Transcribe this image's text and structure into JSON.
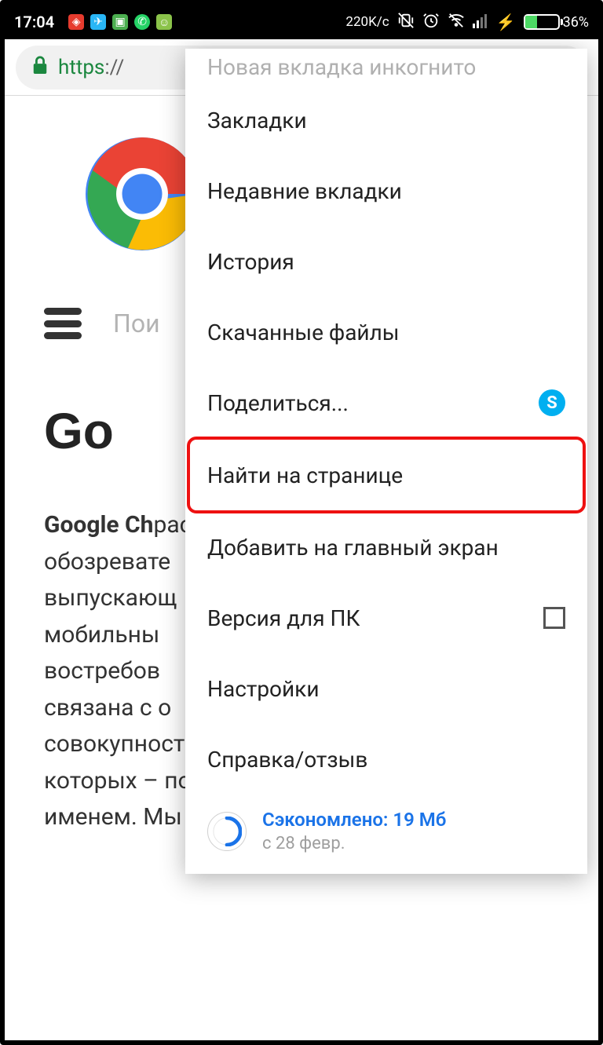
{
  "statusbar": {
    "time": "17:04",
    "speed": "220K/c",
    "battery_pct": "36%",
    "battery_fill": 36
  },
  "address": {
    "scheme": "https",
    "rest": "://"
  },
  "page": {
    "search_placeholder": "Пои",
    "title": "Go",
    "body_bold": "Google Ch",
    "body_rest_lines": "распростр\nобозревате\nвыпускающ\nмобильны\nвостребов\nсвязана с о\nсовокупностью факторов, основной из которых – поддержка компании с мировым именем. Мы рассмотрим"
  },
  "menu": {
    "items": [
      {
        "label": "Новая вкладка инкогнито",
        "truncated": true
      },
      {
        "label": "Закладки"
      },
      {
        "label": "Недавние вкладки"
      },
      {
        "label": "История"
      },
      {
        "label": "Скачанные файлы"
      },
      {
        "label": "Поделиться...",
        "icon": "skype"
      },
      {
        "label": "Найти на странице",
        "highlight": true
      },
      {
        "label": "Добавить на главный экран"
      },
      {
        "label": "Версия для ПК",
        "checkbox": true
      },
      {
        "label": "Настройки"
      },
      {
        "label": "Справка/отзыв"
      }
    ],
    "savings": {
      "line1": "Сэкономлено: 19 Мб",
      "line2": "с 28 февр."
    }
  }
}
